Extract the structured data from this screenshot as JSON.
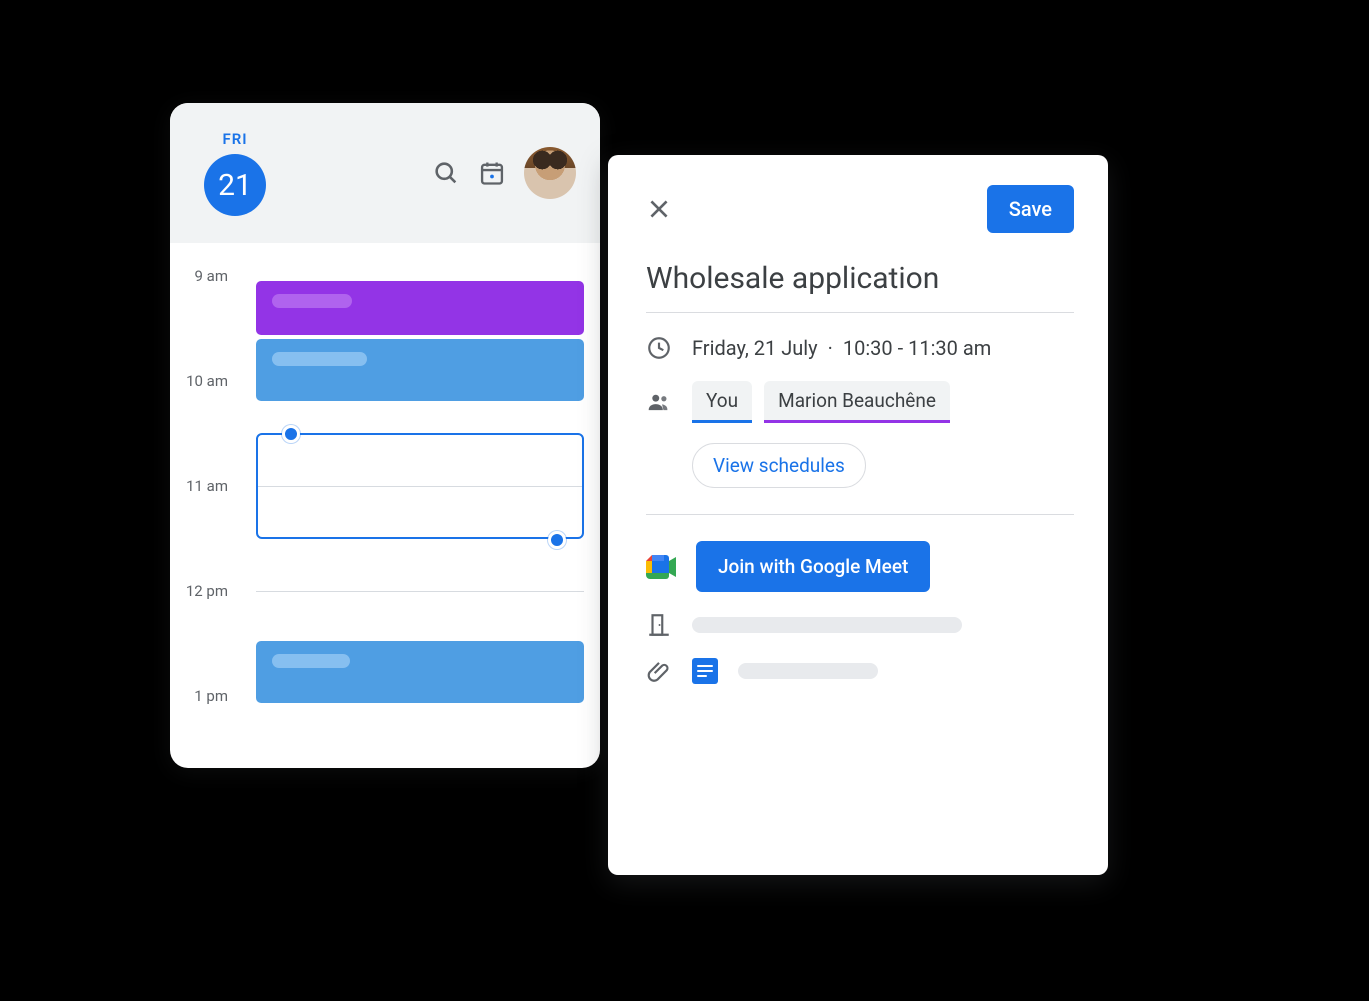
{
  "calendar": {
    "day_name": "FRI",
    "day_number": "21",
    "hours": [
      "9 am",
      "10 am",
      "11 am",
      "12 pm",
      "1 pm"
    ],
    "events": [
      {
        "id": "ev-purple",
        "color": "purple",
        "start": "9:00",
        "end": "9:40"
      },
      {
        "id": "ev-blue",
        "color": "blue",
        "start": "9:45",
        "end": "10:25"
      },
      {
        "id": "ev-blue2",
        "color": "blue",
        "start": "12:30",
        "end": "13:15"
      }
    ],
    "selection": {
      "start": "10:30",
      "end": "11:30"
    }
  },
  "detail": {
    "close_label": "Close",
    "save_label": "Save",
    "title": "Wholesale application",
    "date_text": "Friday, 21 July",
    "time_text": "10:30 - 11:30 am",
    "attendees": {
      "you_label": "You",
      "other_label": "Marion Beauchêne"
    },
    "view_schedules_label": "View schedules",
    "join_meet_label": "Join with Google Meet"
  }
}
